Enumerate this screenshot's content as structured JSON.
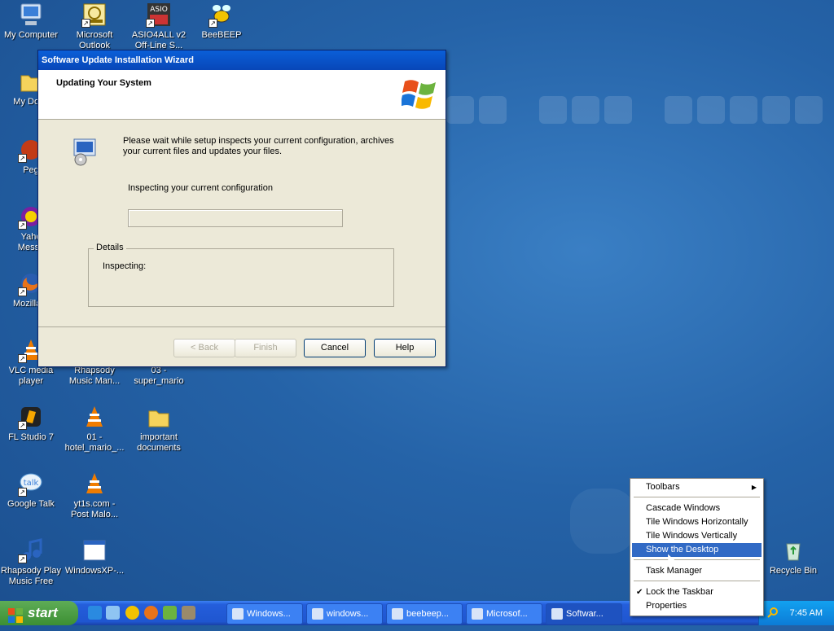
{
  "desktop": {
    "icons": [
      {
        "label": "My Computer",
        "name": "my-computer"
      },
      {
        "label": "Microsoft\nOutlook",
        "name": "microsoft-outlook"
      },
      {
        "label": "ASIO4ALL v2\nOff-Line S...",
        "name": "asio4all"
      },
      {
        "label": "BeeBEEP",
        "name": "beebeep"
      },
      {
        "label": "My Docu",
        "name": "my-documents"
      },
      {
        "label": "Peg",
        "name": "peg"
      },
      {
        "label": "Yaho\nMesse",
        "name": "yahoo-messenger"
      },
      {
        "label": "Mozilla F",
        "name": "mozilla-firefox"
      },
      {
        "label": "VLC media\nplayer",
        "name": "vlc-media-player"
      },
      {
        "label": "Rhapsody\nMusic Man...",
        "name": "rhapsody-music-manager"
      },
      {
        "label": "03 -\nsuper_mario",
        "name": "super-mario"
      },
      {
        "label": "FL Studio 7",
        "name": "fl-studio"
      },
      {
        "label": "01 -\nhotel_mario_...",
        "name": "hotel-mario"
      },
      {
        "label": "important\ndocuments",
        "name": "important-documents"
      },
      {
        "label": "Google Talk",
        "name": "google-talk"
      },
      {
        "label": "yt1s.com -\nPost Malo...",
        "name": "yt1s-post-malone"
      },
      {
        "label": "Rhapsody Play\nMusic Free",
        "name": "rhapsody-play"
      },
      {
        "label": "WindowsXP-...",
        "name": "windowsxp-file"
      },
      {
        "label": "Recycle Bin",
        "name": "recycle-bin"
      }
    ]
  },
  "dialog": {
    "title": "Software Update Installation Wizard",
    "header": "Updating Your System",
    "message": "Please wait while setup inspects your current configuration, archives your current files and updates your files.",
    "status": "Inspecting your current configuration",
    "progress": 0,
    "details_label": "Details",
    "details_text": "Inspecting:",
    "buttons": {
      "back": "< Back",
      "finish": "Finish",
      "cancel": "Cancel",
      "help": "Help"
    }
  },
  "taskbar": {
    "start_label": "start",
    "tasks": [
      "Windows...",
      "windows...",
      "beebeep...",
      "Microsof...",
      "Softwar..."
    ],
    "clock": "7:45 AM"
  },
  "context_menu": {
    "toolbars": "Toolbars",
    "cascade": "Cascade Windows",
    "tile_h": "Tile Windows Horizontally",
    "tile_v": "Tile Windows Vertically",
    "show_desktop": "Show the Desktop",
    "task_manager": "Task Manager",
    "lock": "Lock the Taskbar",
    "properties": "Properties"
  }
}
